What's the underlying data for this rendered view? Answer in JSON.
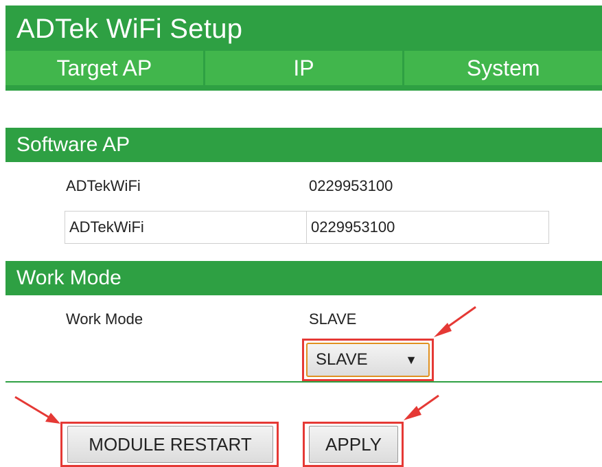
{
  "header": {
    "title": "ADTek WiFi Setup",
    "tabs": [
      "Target AP",
      "IP",
      "System"
    ]
  },
  "software_ap": {
    "section_title": "Software AP",
    "current_ssid": "ADTekWiFi",
    "current_password": "0229953100",
    "ssid_value": "ADTekWiFi",
    "password_value": "0229953100"
  },
  "work_mode": {
    "section_title": "Work Mode",
    "label": "Work Mode",
    "current_value": "SLAVE",
    "select_value": "SLAVE",
    "select_arrow": "▼"
  },
  "buttons": {
    "restart": "MODULE RESTART",
    "apply": "APPLY"
  },
  "colors": {
    "header_green": "#2ea043",
    "tab_green": "#41b64c",
    "highlight_red": "#e53935"
  }
}
